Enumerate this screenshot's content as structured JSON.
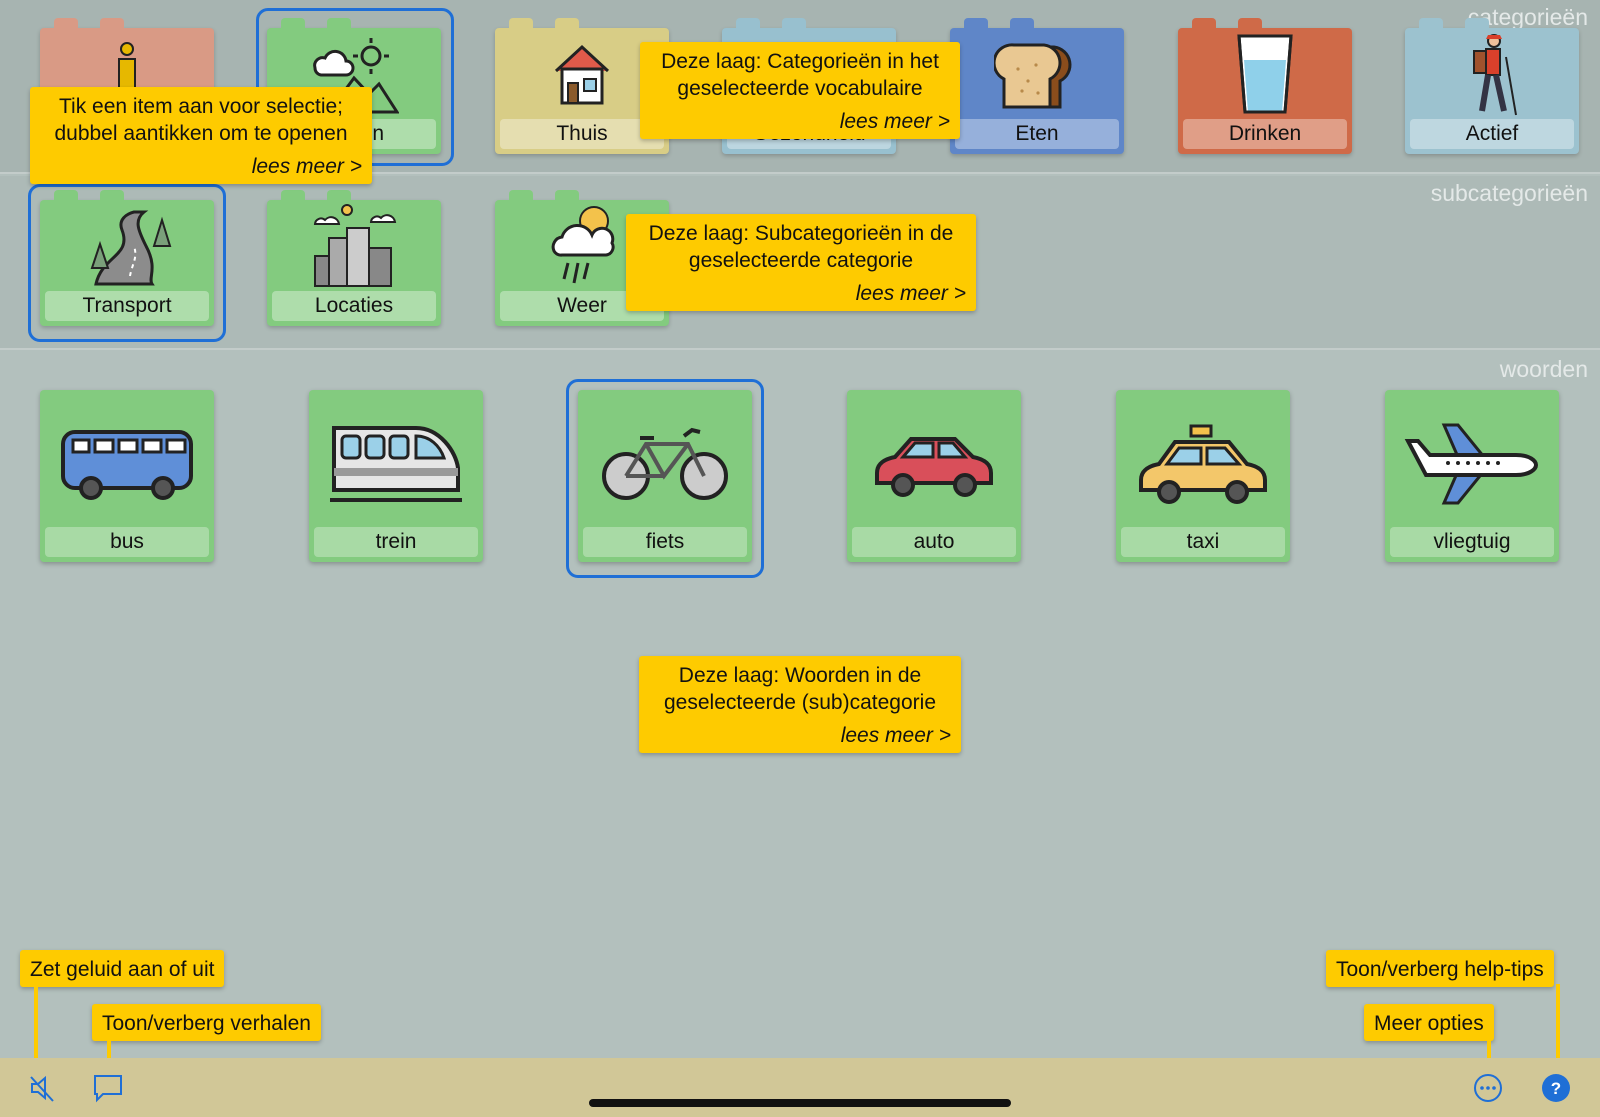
{
  "layers": {
    "categories_label": "categorieën",
    "subcategories_label": "subcategorieën",
    "words_label": "woorden"
  },
  "categories": [
    {
      "label": "",
      "icon": "person-icon",
      "color": "#d99a85"
    },
    {
      "label": "n",
      "icon": "landscape-icon",
      "color": "#83cb7f"
    },
    {
      "label": "Thuis",
      "icon": "house-icon",
      "color": "#d8cd86"
    },
    {
      "label": "Gezondheid",
      "icon": "health-icon",
      "color": "#98c0cf"
    },
    {
      "label": "Eten",
      "icon": "bread-icon",
      "color": "#5f86c8"
    },
    {
      "label": "Drinken",
      "icon": "glass-icon",
      "color": "#cf6a48"
    },
    {
      "label": "Actief",
      "icon": "hiker-icon",
      "color": "#9cc2cf"
    }
  ],
  "subcategories": [
    {
      "label": "Transport",
      "icon": "road-icon"
    },
    {
      "label": "Locaties",
      "icon": "buildings-icon"
    },
    {
      "label": "Weer",
      "icon": "weather-icon"
    }
  ],
  "words": [
    {
      "label": "bus",
      "icon": "bus-icon"
    },
    {
      "label": "trein",
      "icon": "train-icon"
    },
    {
      "label": "fiets",
      "icon": "bicycle-icon"
    },
    {
      "label": "auto",
      "icon": "car-icon"
    },
    {
      "label": "taxi",
      "icon": "taxi-icon"
    },
    {
      "label": "vliegtuig",
      "icon": "airplane-icon"
    }
  ],
  "tips": {
    "select": {
      "line1": "Tik een item aan voor selectie;",
      "line2": "dubbel aantikken om te openen",
      "more": "lees meer >"
    },
    "categories": {
      "line1": "Deze laag: Categorieën in het",
      "line2": "geselecteerde vocabulaire",
      "more": "lees meer >"
    },
    "subcategories": {
      "line1": "Deze laag: Subcategorieën in de",
      "line2": "geselecteerde categorie",
      "more": "lees meer >"
    },
    "words": {
      "line1": "Deze laag: Woorden in de",
      "line2": "geselecteerde (sub)categorie",
      "more": "lees meer >"
    },
    "sound": "Zet geluid aan of uit",
    "stories": "Toon/verberg verhalen",
    "help": "Toon/verberg help-tips",
    "more_options": "Meer opties"
  },
  "colors": {
    "tip": "#fecb00",
    "selection": "#1f6fd6",
    "word_tile": "#83cb7f",
    "bottom_bar": "#d1c797"
  }
}
